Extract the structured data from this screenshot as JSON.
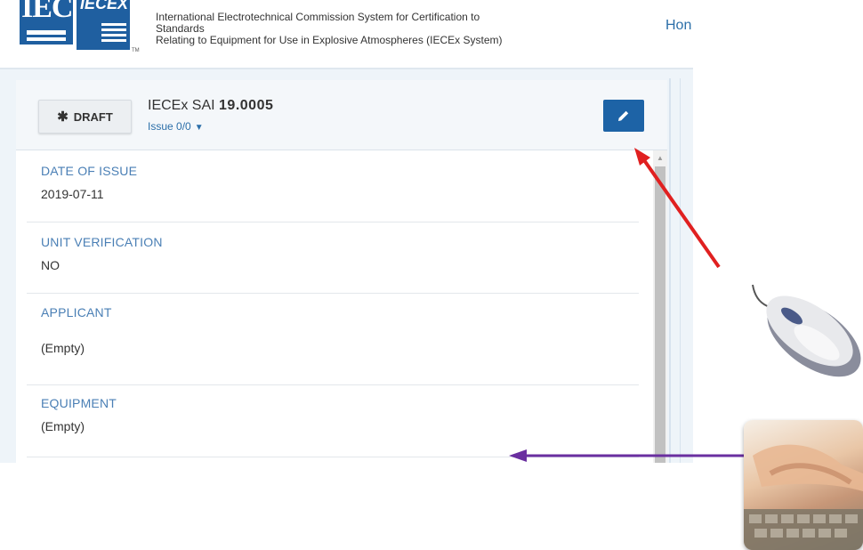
{
  "header": {
    "logo_iec_text": "IEC",
    "logo_iecex_text": "IECEX",
    "tm": "TM",
    "title_lines": [
      "International Electrotechnical Commission System for Certification to",
      "Standards",
      "Relating to Equipment for Use in Explosive Atmospheres (IECEx System)"
    ],
    "home_link": "Hon"
  },
  "card": {
    "draft_label": "DRAFT",
    "cert_prefix": "IECEx SAI",
    "cert_number": "19.0005",
    "issue_label": "Issue 0/0",
    "edit_icon": "pencil-icon",
    "draft_icon": "gear-icon"
  },
  "fields": [
    {
      "label": "DATE OF ISSUE",
      "value": "2019-07-11"
    },
    {
      "label": "UNIT VERIFICATION",
      "value": "NO"
    },
    {
      "label": "APPLICANT",
      "value": "(Empty)"
    },
    {
      "label": "EQUIPMENT",
      "value": "(Empty)"
    }
  ],
  "colors": {
    "accent": "#1d63a6",
    "label": "#4a7fb5",
    "red_arrow": "#e02020",
    "purple_arrow": "#6a2fa0"
  }
}
